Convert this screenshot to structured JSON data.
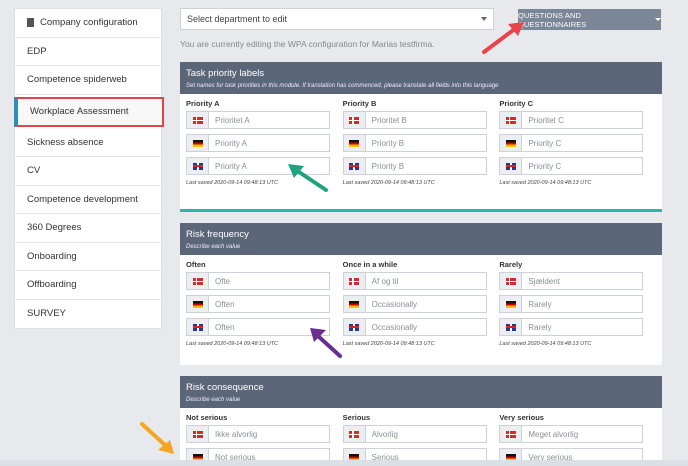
{
  "sidebar": {
    "items": [
      {
        "label": "Company configuration",
        "icon": "building-icon"
      },
      {
        "label": "EDP"
      },
      {
        "label": "Competence spiderweb"
      },
      {
        "label": "Workplace Assessment",
        "active": true
      },
      {
        "label": "Sickness absence"
      },
      {
        "label": "CV"
      },
      {
        "label": "Competence development"
      },
      {
        "label": "360 Degrees"
      },
      {
        "label": "Onboarding"
      },
      {
        "label": "Offboarding"
      },
      {
        "label": "SURVEY"
      }
    ]
  },
  "topbar": {
    "department_select": "Select department to edit",
    "questions_button": "QUESTIONS AND QUESTIONNAIRES",
    "editing_note": "You are currently editing the WPA configuration for Marias testfirma."
  },
  "task_priority": {
    "title": "Task priority labels",
    "subtitle": "Set names for task priorities in this module. If translation has commenced, please translate all fields into this language",
    "columns": [
      {
        "label": "Priority A",
        "values": [
          "Prioritet A",
          "Priority A",
          "Priority A"
        ],
        "saved": "Last saved 2020-09-14 09:48:13 UTC"
      },
      {
        "label": "Priority B",
        "values": [
          "Prioritet B",
          "Priority B",
          "Priority B"
        ],
        "saved": "Last saved 2020-09-14 09:48:13 UTC"
      },
      {
        "label": "Priority C",
        "values": [
          "Prioritet C",
          "Priority C",
          "Priority C"
        ],
        "saved": "Last saved 2020-09-14 09:48:13 UTC"
      }
    ]
  },
  "risk_frequency": {
    "title": "Risk frequency",
    "subtitle": "Describe each value",
    "columns": [
      {
        "label": "Often",
        "values": [
          "Ofte",
          "Often",
          "Often"
        ],
        "saved": "Last saved 2020-09-14 09:48:13 UTC"
      },
      {
        "label": "Once in a while",
        "values": [
          "Af og til",
          "Occasionally",
          "Occasionally"
        ],
        "saved": "Last saved 2020-09-14 09:48:13 UTC"
      },
      {
        "label": "Rarely",
        "values": [
          "Sjældent",
          "Rarely",
          "Rarely"
        ],
        "saved": "Last saved 2020-09-14 09:48:13 UTC"
      }
    ]
  },
  "risk_consequence": {
    "title": "Risk consequence",
    "subtitle": "Describe each value",
    "columns": [
      {
        "label": "Not serious",
        "values": [
          "Ikke alvorlig",
          "Not serious"
        ]
      },
      {
        "label": "Serious",
        "values": [
          "Alvorlig",
          "Serious"
        ]
      },
      {
        "label": "Very serious",
        "values": [
          "Meget alvorlig",
          "Very serious"
        ]
      }
    ]
  },
  "flags": [
    "dk-flag-icon",
    "de-flag-icon",
    "gb-flag-icon"
  ],
  "colors": {
    "card_header": "#5c6679",
    "accent_green": "#27b9a5",
    "highlight_red": "#e0454c",
    "active_blue": "#2b8fb7",
    "arrow_red": "#e8434a",
    "arrow_green": "#1fa37e",
    "arrow_purple": "#6b2d8f",
    "arrow_orange": "#f4a622"
  }
}
